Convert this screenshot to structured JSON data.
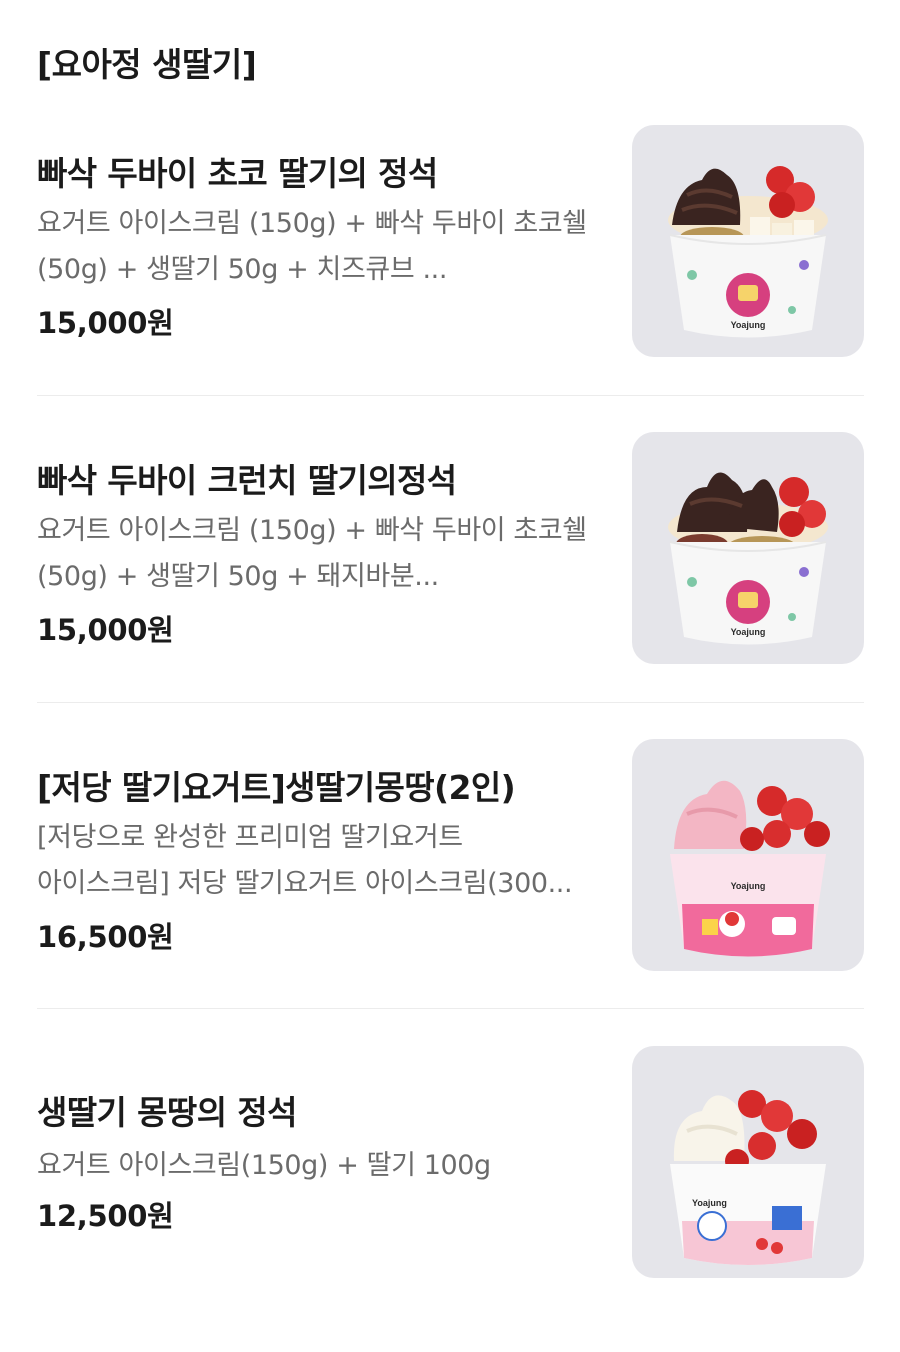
{
  "section": {
    "title": "[요아정 생딸기]"
  },
  "items": [
    {
      "name": "빠삭 두바이 초코 딸기의 정석",
      "description": "요거트 아이스크림 (150g) + 빠삭 두바이 초코쉘 (50g) + 생딸기 50g + 치즈큐브 ...",
      "price": "15,000원",
      "image": {
        "brand": "Yoajung",
        "icon": "yogurt-bowl-choco-strawberry-cheese"
      }
    },
    {
      "name": "빠삭 두바이 크런치 딸기의정석",
      "description": "요거트 아이스크림 (150g) + 빠삭 두바이 초코쉘 (50g) + 생딸기 50g + 돼지바분...",
      "price": "15,000원",
      "image": {
        "brand": "Yoajung",
        "icon": "yogurt-bowl-choco-strawberry-crunch"
      }
    },
    {
      "name": "[저당 딸기요거트]생딸기몽땅(2인)",
      "description": "[저당으로 완성한 프리미엄 딸기요거트 아이스크림] 저당 딸기요거트 아이스크림(300...",
      "price": "16,500원",
      "image": {
        "brand": "Yoajung",
        "icon": "yogurt-bowl-pink-strawberry"
      }
    },
    {
      "name": "생딸기 몽땅의 정석",
      "description": "요거트 아이스크림(150g) + 딸기 100g",
      "price": "12,500원",
      "image": {
        "brand": "Yoajung",
        "icon": "yogurt-bowl-white-strawberry"
      }
    }
  ],
  "colors": {
    "text": "#1b1b1b",
    "description": "#6b6b6b",
    "divider": "#ececec",
    "thumb_bg": "#e5e5ea",
    "brand_pink": "#d6407f"
  }
}
